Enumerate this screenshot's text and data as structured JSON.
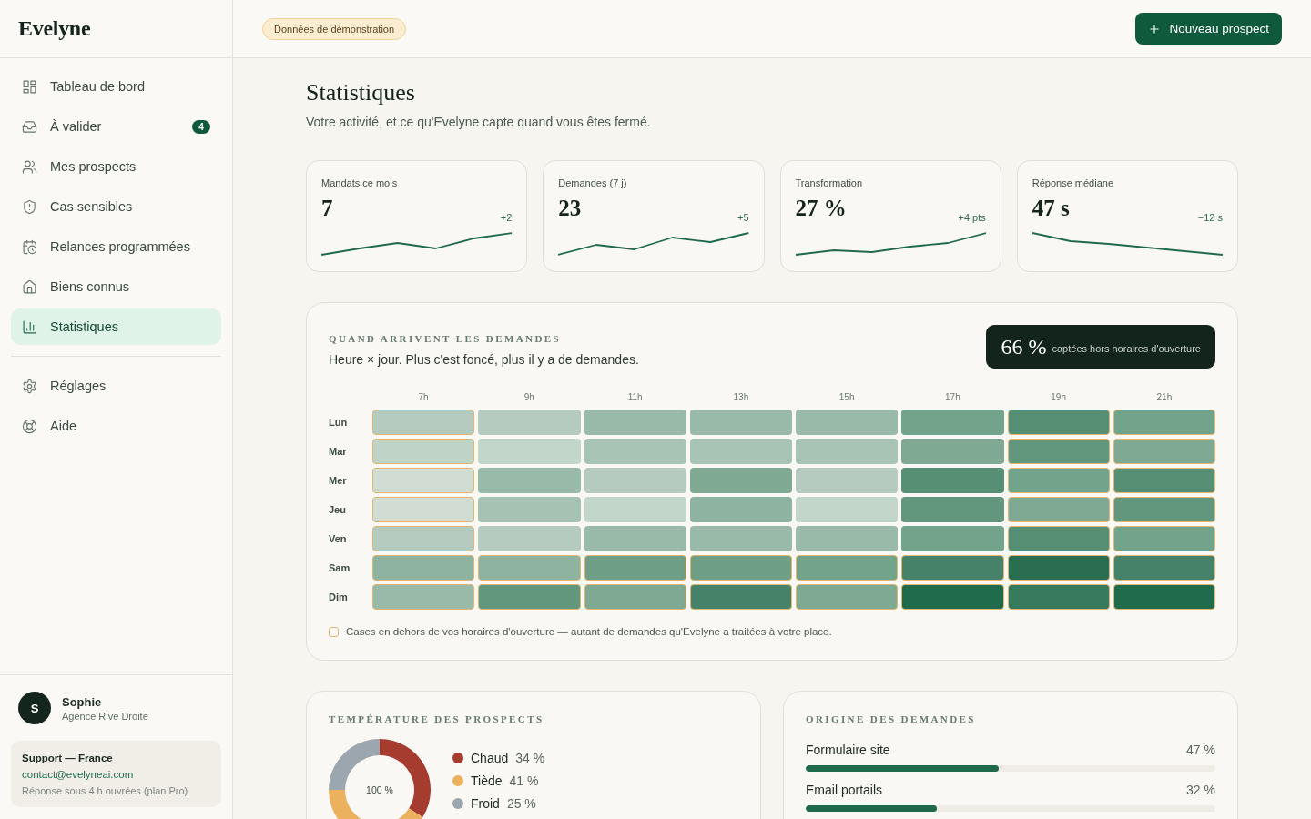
{
  "sidebar": {
    "logo": "Evelyne",
    "nav": [
      {
        "label": "Tableau de bord",
        "selected": false
      },
      {
        "label": "À valider",
        "selected": false,
        "badge": "4"
      },
      {
        "label": "Mes prospects",
        "selected": false
      },
      {
        "label": "Cas sensibles",
        "selected": false
      },
      {
        "label": "Relances programmées",
        "selected": false
      },
      {
        "label": "Biens connus",
        "selected": false
      },
      {
        "label": "Statistiques",
        "selected": true
      }
    ],
    "secondary_nav": [
      {
        "label": "Réglages",
        "selected": false
      },
      {
        "label": "Aide",
        "selected": false
      }
    ],
    "user": {
      "initial": "S",
      "name": "Sophie",
      "agency": "Agence Rive Droite"
    },
    "support": {
      "title": "Support — France",
      "email": "contact@evelyneai.com",
      "note": "Réponse sous 4 h ouvrées (plan Pro)"
    }
  },
  "topbar": {
    "demo_badge": "Données de démonstration",
    "new_button": "Nouveau prospect"
  },
  "page": {
    "title": "Statistiques",
    "subtitle": "Votre activité, et ce qu'Evelyne capte quand vous êtes fermé."
  },
  "kpis": [
    {
      "label": "Mandats ce mois",
      "value": "7",
      "delta": "+2"
    },
    {
      "label": "Demandes (7 j)",
      "value": "23",
      "delta": "+5"
    },
    {
      "label": "Transformation",
      "value": "27 %",
      "delta": "+4 pts"
    },
    {
      "label": "Réponse médiane",
      "value": "47 s",
      "delta": "−12 s"
    }
  ],
  "heatmap": {
    "title": "QUAND ARRIVENT LES DEMANDES",
    "subtitle": "Heure × jour. Plus c'est foncé, plus il y a de demandes.",
    "callout": {
      "value": "66 %",
      "caption": "captées hors horaires d'ouverture"
    },
    "hours": [
      "7h",
      "9h",
      "11h",
      "13h",
      "15h",
      "17h",
      "19h",
      "21h"
    ],
    "rows": [
      {
        "day": "Lun",
        "cells": [
          {
            "color": "#b5cbbf",
            "after_hours": true
          },
          {
            "color": "#b5cbbf",
            "after_hours": false
          },
          {
            "color": "#9abaa9",
            "after_hours": false
          },
          {
            "color": "#9abaa9",
            "after_hours": false
          },
          {
            "color": "#9abaa9",
            "after_hours": false
          },
          {
            "color": "#72a38b",
            "after_hours": false
          },
          {
            "color": "#568f74",
            "after_hours": true
          },
          {
            "color": "#72a38b",
            "after_hours": true
          }
        ]
      },
      {
        "day": "Mar",
        "cells": [
          {
            "color": "#bfd3c6",
            "after_hours": true
          },
          {
            "color": "#c3d6ca",
            "after_hours": false
          },
          {
            "color": "#a8c4b4",
            "after_hours": false
          },
          {
            "color": "#a8c4b4",
            "after_hours": false
          },
          {
            "color": "#a8c4b4",
            "after_hours": false
          },
          {
            "color": "#80a993",
            "after_hours": false
          },
          {
            "color": "#62977d",
            "after_hours": true
          },
          {
            "color": "#80a993",
            "after_hours": true
          }
        ]
      },
      {
        "day": "Mer",
        "cells": [
          {
            "color": "#d1ddd3",
            "after_hours": true
          },
          {
            "color": "#9abaa9",
            "after_hours": false
          },
          {
            "color": "#b5cbbf",
            "after_hours": false
          },
          {
            "color": "#80a993",
            "after_hours": false
          },
          {
            "color": "#b5cbbf",
            "after_hours": false
          },
          {
            "color": "#568f74",
            "after_hours": false
          },
          {
            "color": "#72a38b",
            "after_hours": true
          },
          {
            "color": "#568f74",
            "after_hours": true
          }
        ]
      },
      {
        "day": "Jeu",
        "cells": [
          {
            "color": "#d1ddd3",
            "after_hours": true
          },
          {
            "color": "#a5c2b2",
            "after_hours": false
          },
          {
            "color": "#c3d6ca",
            "after_hours": false
          },
          {
            "color": "#8eb3a0",
            "after_hours": false
          },
          {
            "color": "#c3d6ca",
            "after_hours": false
          },
          {
            "color": "#62977d",
            "after_hours": false
          },
          {
            "color": "#80a993",
            "after_hours": true
          },
          {
            "color": "#62977d",
            "after_hours": true
          }
        ]
      },
      {
        "day": "Ven",
        "cells": [
          {
            "color": "#b5cbbf",
            "after_hours": true
          },
          {
            "color": "#b5cbbf",
            "after_hours": false
          },
          {
            "color": "#9abaa9",
            "after_hours": false
          },
          {
            "color": "#9abaa9",
            "after_hours": false
          },
          {
            "color": "#9abaa9",
            "after_hours": false
          },
          {
            "color": "#72a38b",
            "after_hours": false
          },
          {
            "color": "#568f74",
            "after_hours": true
          },
          {
            "color": "#72a38b",
            "after_hours": true
          }
        ]
      },
      {
        "day": "Sam",
        "cells": [
          {
            "color": "#8eb3a0",
            "after_hours": true
          },
          {
            "color": "#8eb3a0",
            "after_hours": true
          },
          {
            "color": "#6e9f86",
            "after_hours": true
          },
          {
            "color": "#6e9f86",
            "after_hours": true
          },
          {
            "color": "#72a38b",
            "after_hours": true
          },
          {
            "color": "#468169",
            "after_hours": true
          },
          {
            "color": "#2a6e51",
            "after_hours": true
          },
          {
            "color": "#468169",
            "after_hours": true
          }
        ]
      },
      {
        "day": "Dim",
        "cells": [
          {
            "color": "#9abaa9",
            "after_hours": true
          },
          {
            "color": "#62977d",
            "after_hours": true
          },
          {
            "color": "#80a993",
            "after_hours": true
          },
          {
            "color": "#468169",
            "after_hours": true
          },
          {
            "color": "#80a993",
            "after_hours": true
          },
          {
            "color": "#1f6b4b",
            "after_hours": true
          },
          {
            "color": "#387a5d",
            "after_hours": true
          },
          {
            "color": "#1f6b4b",
            "after_hours": true
          }
        ]
      }
    ],
    "legend": "Cases en dehors de vos horaires d'ouverture — autant de demandes qu'Evelyne a traitées à votre place."
  },
  "temperature": {
    "title": "TEMPÉRATURE DES PROSPECTS",
    "center_label": "100 %",
    "chart_data": {
      "type": "donut",
      "categories": [
        "Chaud",
        "Tiède",
        "Froid"
      ],
      "values": [
        34,
        41,
        25
      ]
    },
    "legend": [
      {
        "value": "34 %",
        "color": "#a63b30"
      },
      {
        "value": "41 %",
        "color": "#ecb15f"
      },
      {
        "value": "25 %",
        "color": "#9ba6ae"
      }
    ]
  },
  "origins": {
    "title": "ORIGINE DES DEMANDES",
    "items": [
      {
        "label": "Formulaire site",
        "value": "47 %",
        "level": 0.47
      },
      {
        "label": "Email portails",
        "value": "32 %",
        "level": 0.32
      }
    ]
  }
}
